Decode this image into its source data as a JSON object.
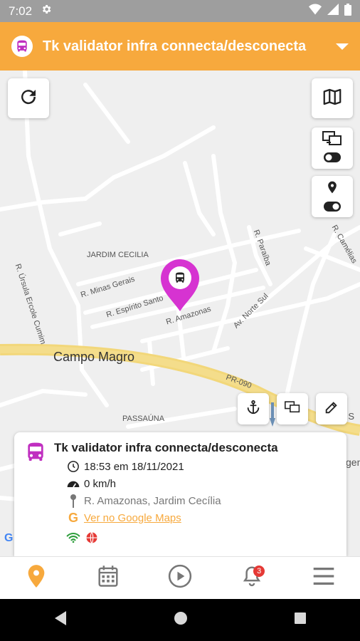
{
  "status_bar": {
    "time": "7:02"
  },
  "app_bar": {
    "title": "Tk validator infra connecta/desconecta"
  },
  "map": {
    "labels": {
      "neighborhood_1": "JARDIM CECILIA",
      "neighborhood_2": "PASSAÚNA",
      "city": "Campo Magro",
      "street_ursula": "R. Úrsula Ercole Cumim",
      "street_minas": "R. Minas Gerais",
      "street_espirito": "R. Espírito Santo",
      "street_amazonas": "R. Amazonas",
      "street_paraiba": "R. Paraíba",
      "street_norte_sul": "Av. Norte Sul",
      "street_camelias": "R. Camélias",
      "highway": "PR-090",
      "partial_right_1": "os S",
      "partial_right_2": "gen"
    }
  },
  "info_card": {
    "title": "Tk validator infra connecta/desconecta",
    "timestamp": "18:53 em 18/11/2021",
    "speed": "0 km/h",
    "address": "R. Amazonas, Jardim Cecília",
    "maps_link": "Ver no Google Maps"
  },
  "bottom_nav": {
    "notifications_count": "3"
  },
  "colors": {
    "accent": "#f7a93d",
    "marker": "#d633d1",
    "bus": "#c02fc0"
  }
}
